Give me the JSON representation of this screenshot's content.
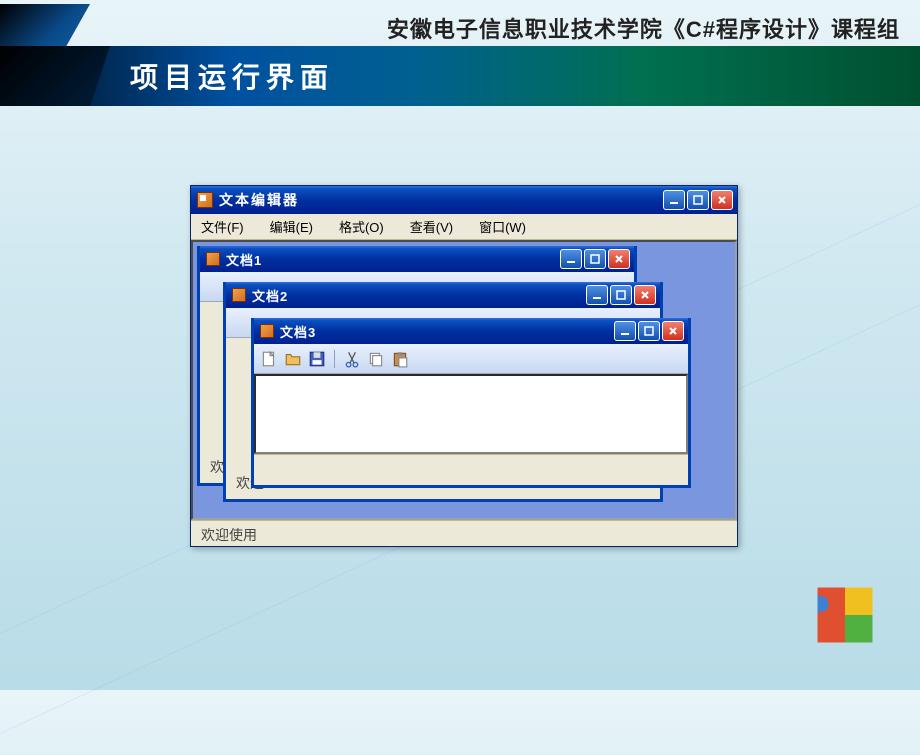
{
  "slide": {
    "header_text": "安徽电子信息职业技术学院《C#程序设计》课程组",
    "banner_title": "项目运行界面"
  },
  "app": {
    "title": "文本编辑器",
    "menu": {
      "file": "文件(F)",
      "edit": "编辑(E)",
      "format": "格式(O)",
      "view": "查看(V)",
      "window": "窗口(W)"
    },
    "statusbar_text": "欢迎使用",
    "children": {
      "doc1": {
        "title": "文档1",
        "status_partial": "欢"
      },
      "doc2": {
        "title": "文档2",
        "status_partial": "欢迎"
      },
      "doc3": {
        "title": "文档3"
      }
    },
    "toolbar_icons": {
      "new": "new-file-icon",
      "open": "open-folder-icon",
      "save": "save-disk-icon",
      "cut": "cut-icon",
      "copy": "copy-icon",
      "paste": "paste-icon"
    }
  }
}
